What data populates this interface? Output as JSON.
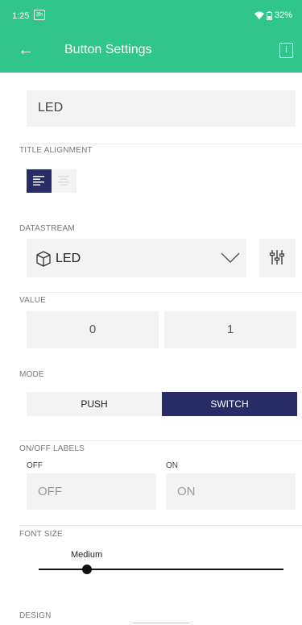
{
  "status_bar": {
    "time": "1:25",
    "notification_badge": "ठh",
    "battery": "32%"
  },
  "app_bar": {
    "title": "Button Settings",
    "back_icon": "arrow-left-icon",
    "info_icon": "info-icon",
    "info_glyph": "i"
  },
  "widget_name": {
    "value": "LED"
  },
  "title_alignment": {
    "label": "TITLE ALIGNMENT",
    "selected": "left"
  },
  "datastream": {
    "label": "DATASTREAM",
    "selected": "LED",
    "icon": "cube-icon"
  },
  "value": {
    "label": "VALUE",
    "off_value": "0",
    "on_value": "1"
  },
  "mode": {
    "label": "MODE",
    "options": [
      "PUSH",
      "SWITCH"
    ],
    "selected": "SWITCH"
  },
  "on_off_labels": {
    "label": "ON/OFF LABELS",
    "off_caption": "OFF",
    "on_caption": "ON",
    "off_placeholder": "OFF",
    "on_placeholder": "ON"
  },
  "font_size": {
    "label": "FONT SIZE",
    "value_label": "Medium",
    "level": 0.2
  },
  "design": {
    "label": "DESIGN"
  },
  "colors": {
    "accent_green": "#2fc58b",
    "selected_navy": "#282c66"
  }
}
